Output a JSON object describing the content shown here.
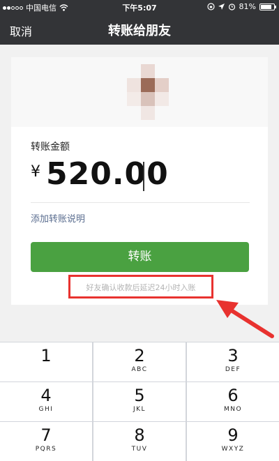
{
  "status_bar": {
    "carrier": "中国电信",
    "time": "下午5:07",
    "battery_percent": "81%",
    "battery_level": 0.81
  },
  "nav": {
    "cancel": "取消",
    "title": "转账给朋友"
  },
  "card": {
    "amount_label": "转账金额",
    "currency_symbol": "¥",
    "amount": "520.00",
    "add_note": "添加转账说明",
    "transfer_button": "转账",
    "hint": "好友确认收款后延迟24小时入账"
  },
  "colors": {
    "header_bg": "#333437",
    "button_green": "#4aa141",
    "annotation_red": "#e8322f",
    "link_blue": "#5a6d8f"
  },
  "keypad": {
    "keys": [
      {
        "num": "1",
        "letters": ""
      },
      {
        "num": "2",
        "letters": "ABC"
      },
      {
        "num": "3",
        "letters": "DEF"
      },
      {
        "num": "4",
        "letters": "GHI"
      },
      {
        "num": "5",
        "letters": "JKL"
      },
      {
        "num": "6",
        "letters": "MNO"
      },
      {
        "num": "7",
        "letters": "PQRS"
      },
      {
        "num": "8",
        "letters": "TUV"
      },
      {
        "num": "9",
        "letters": "WXYZ"
      }
    ]
  }
}
